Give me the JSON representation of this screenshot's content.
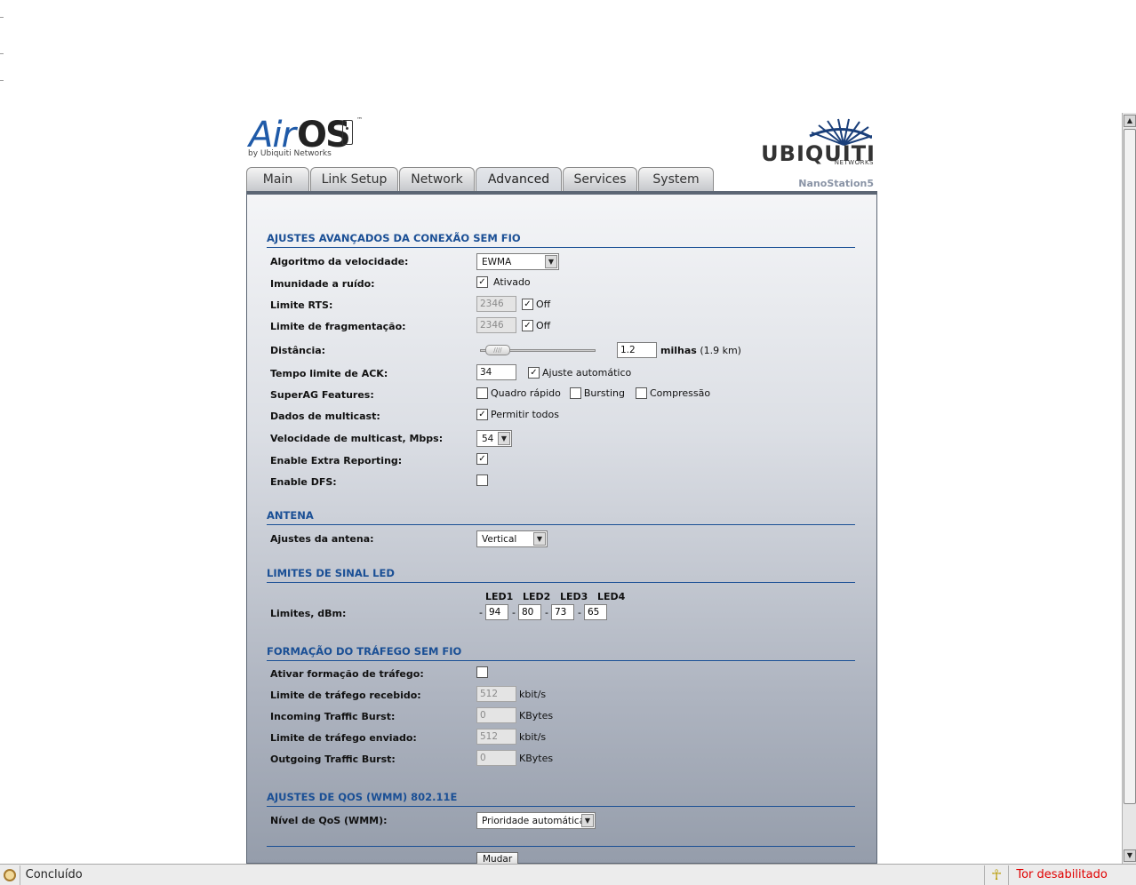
{
  "header": {
    "logo_air": "Air",
    "logo_os": "OS",
    "logo_tm": "™",
    "logo_by": "by Ubiquiti Networks",
    "brand": "UBIQUITI",
    "brand_sub": "NETWORKS",
    "device": "NanoStation5"
  },
  "tabs": [
    {
      "label": "Main",
      "active": false
    },
    {
      "label": "Link Setup",
      "active": false
    },
    {
      "label": "Network",
      "active": false
    },
    {
      "label": "Advanced",
      "active": true
    },
    {
      "label": "Services",
      "active": false
    },
    {
      "label": "System",
      "active": false
    }
  ],
  "wireless": {
    "title": "AJUSTES AVANÇADOS DA CONEXÃO SEM FIO",
    "rate_algorithm": {
      "label": "Algoritmo da velocidade:",
      "value": "EWMA"
    },
    "noise_immunity": {
      "label": "Imunidade a ruído:",
      "checked": true,
      "option": "Ativado"
    },
    "rts": {
      "label": "Limite RTS:",
      "value": "2346",
      "off_checked": true,
      "off_label": "Off"
    },
    "fragmentation": {
      "label": "Limite de fragmentação:",
      "value": "2346",
      "off_checked": true,
      "off_label": "Off"
    },
    "distance": {
      "label": "Distância:",
      "value": "1.2",
      "unit": "milhas",
      "km": "(1.9 km)",
      "slider_fraction": 0.02
    },
    "ack": {
      "label": "Tempo limite de ACK:",
      "value": "34",
      "auto_checked": true,
      "auto_label": "Ajuste automático"
    },
    "superag": {
      "label": "SuperAG Features:",
      "fast_frame": "Quadro rápido",
      "bursting": "Bursting",
      "compression": "Compressão"
    },
    "multicast": {
      "label": "Dados de multicast:",
      "checked": true,
      "option": "Permitir todos"
    },
    "multicast_rate": {
      "label": "Velocidade de multicast, Mbps:",
      "value": "54"
    },
    "extra_reporting": {
      "label": "Enable Extra Reporting:",
      "checked": true
    },
    "dfs": {
      "label": "Enable DFS:",
      "checked": false
    }
  },
  "antenna": {
    "title": "ANTENA",
    "setting": {
      "label": "Ajustes da antena:",
      "value": "Vertical"
    }
  },
  "led": {
    "title": "LIMITES DE SINAL LED",
    "label": "Limites, dBm:",
    "headers": [
      "LED1",
      "LED2",
      "LED3",
      "LED4"
    ],
    "prefix": "-",
    "values": [
      "94",
      "80",
      "73",
      "65"
    ]
  },
  "shaping": {
    "title": "FORMAÇÃO DO TRÁFEGO SEM FIO",
    "enable": {
      "label": "Ativar formação de tráfego:",
      "checked": false
    },
    "in_limit": {
      "label": "Limite de tráfego recebido:",
      "value": "512",
      "unit": "kbit/s"
    },
    "in_burst": {
      "label": "Incoming Traffic Burst:",
      "value": "0",
      "unit": "KBytes"
    },
    "out_limit": {
      "label": "Limite de tráfego enviado:",
      "value": "512",
      "unit": "kbit/s"
    },
    "out_burst": {
      "label": "Outgoing Traffic Burst:",
      "value": "0",
      "unit": "KBytes"
    }
  },
  "qos": {
    "title": "AJUSTES DE QOS (WMM) 802.11E",
    "level": {
      "label": "Nível de QoS (WMM):",
      "value": "Prioridade automática"
    }
  },
  "submit_label": "Mudar",
  "statusbar": {
    "text": "Concluído",
    "tor": "Tor desabilitado"
  }
}
